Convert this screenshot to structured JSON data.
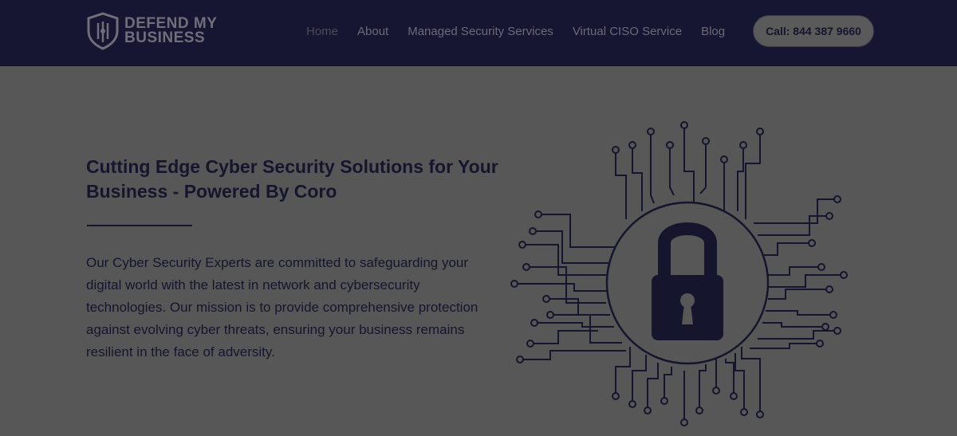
{
  "header": {
    "logo_line1": "DEFEND MY",
    "logo_line2": "BUSINESS",
    "nav": [
      {
        "label": "Home"
      },
      {
        "label": "About"
      },
      {
        "label": "Managed Security Services"
      },
      {
        "label": "Virtual CISO Service"
      },
      {
        "label": "Blog"
      }
    ],
    "call_label": "Call: 844 387 9660"
  },
  "hero": {
    "title": "Cutting Edge Cyber Security Solutions for Your Business - Powered By Coro",
    "description": "Our Cyber Security Experts are committed to safeguarding your digital world with the latest in network and cybersecurity technologies. Our mission is to provide comprehensive protection against evolving cyber threats, ensuring your business remains resilient in the face of adversity."
  },
  "colors": {
    "header_bg": "#161632",
    "overlay_bg": "#575757",
    "text_dark": "#15152d"
  },
  "icons": [
    "shield-logo-icon",
    "padlock-icon",
    "circuit-lines-icon"
  ]
}
